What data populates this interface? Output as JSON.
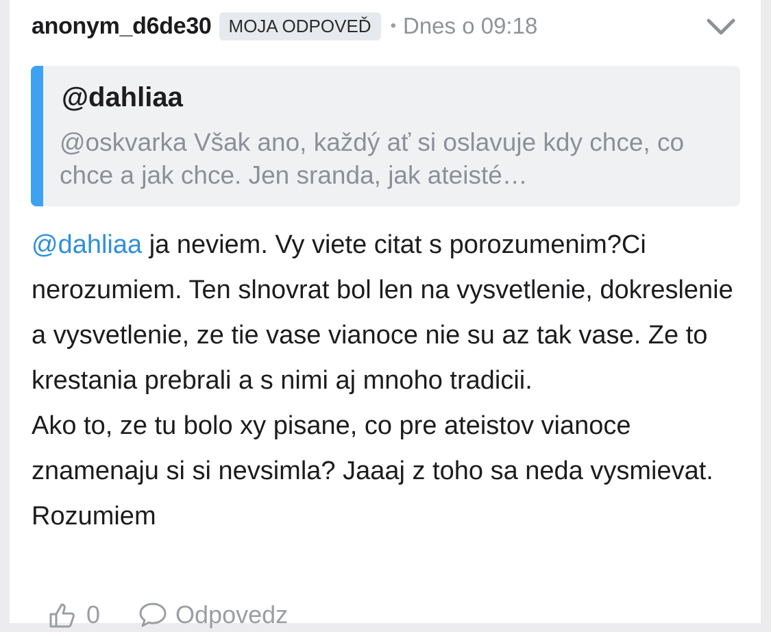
{
  "comment": {
    "author": "anonym_d6de30",
    "badge": "MOJA ODPOVEĎ",
    "separator": "•",
    "timestamp": "Dnes o 09:18",
    "quote": {
      "author": "@dahliaa",
      "text": "@oskvarka Však ano, každý ať si oslavuje kdy chce, co chce a jak chce. Jen sranda, jak ateisté…"
    },
    "body": {
      "mention": "@dahliaa",
      "paragraph_1": " ja neviem. Vy viete citat s porozumenim?Ci nerozumiem. Ten slnovrat bol len na vysvetlenie, dokreslenie a vysvetlenie, ze tie vase vianoce nie su az tak vase. Ze to krestania prebrali a s nimi aj mnoho tradicii.",
      "paragraph_2": "Ako to, ze tu bolo xy pisane, co pre ateistov vianoce znamenaju si si nevsimla? Jaaaj z toho sa neda vysmievat. Rozumiem"
    },
    "actions": {
      "like_count": "0",
      "reply_label": "Odpovedz"
    }
  },
  "icons": {
    "expand": "chevron-down-icon",
    "like": "thumbs-up-icon",
    "reply": "speech-bubble-icon"
  },
  "colors": {
    "accent": "#3ea2f2",
    "mention": "#2f8fdc",
    "muted": "#8f9398",
    "badge_bg": "#e6e9ed"
  }
}
